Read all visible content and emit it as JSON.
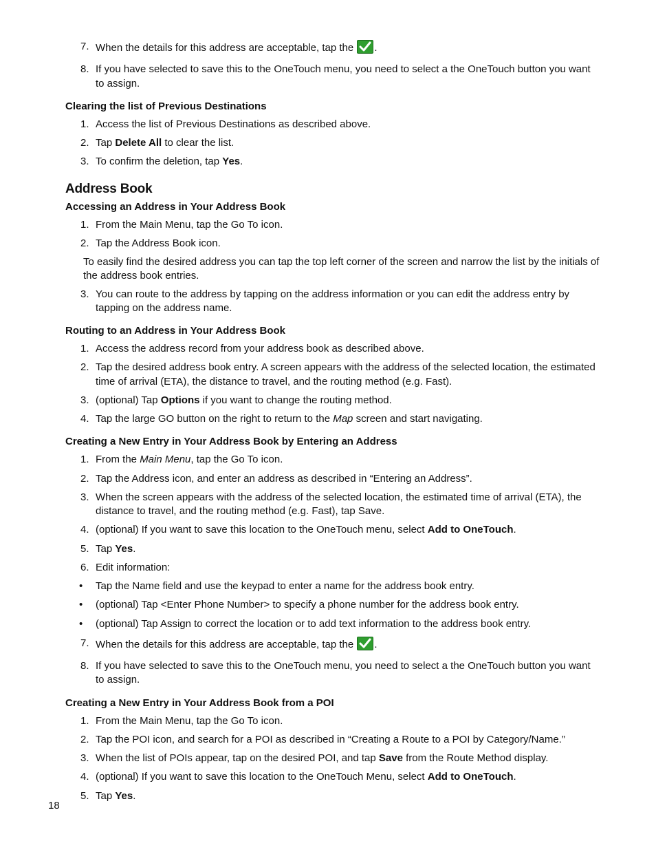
{
  "icons": {
    "check_name": "check-icon"
  },
  "top_list": {
    "i7": {
      "marker": "7.",
      "pre": "When the details for this address are acceptable, tap the ",
      "post": "."
    },
    "i8": {
      "marker": "8.",
      "text": "If you have selected to save this to the OneTouch menu, you need to select a the OneTouch button you want to assign."
    }
  },
  "clearing": {
    "heading": "Clearing the list of Previous Destinations",
    "i1": {
      "marker": "1.",
      "text": "Access the list of Previous Destinations as described above."
    },
    "i2": {
      "marker": "2.",
      "pre": "Tap ",
      "bold": "Delete All",
      "post": " to clear the list."
    },
    "i3": {
      "marker": "3.",
      "pre": "To confirm the deletion, tap ",
      "bold": "Yes",
      "post": "."
    }
  },
  "address_book_heading": "Address Book",
  "accessing": {
    "heading": "Accessing an Address in Your Address Book",
    "i1": {
      "marker": "1.",
      "text": "From the Main Menu, tap the Go To icon."
    },
    "i2": {
      "marker": "2.",
      "text": "Tap the Address Book icon."
    },
    "note": "To easily find the desired address you can tap the top left corner of the screen and narrow the list by the initials of the address book entries.",
    "i3": {
      "marker": "3.",
      "text": "You can route to the address by tapping on the address information or you can edit the address entry by tapping on the address name."
    }
  },
  "routing": {
    "heading": "Routing to an Address in Your Address Book",
    "i1": {
      "marker": "1.",
      "text": "Access the address record from your address book as described above."
    },
    "i2": {
      "marker": "2.",
      "text": "Tap the desired address book entry. A screen appears with the address of the selected location, the estimated time of arrival (ETA), the distance to travel, and the routing method (e.g. Fast)."
    },
    "i3": {
      "marker": "3.",
      "pre": "(optional) Tap ",
      "bold": "Options",
      "post": " if you want to change the routing method."
    },
    "i4": {
      "marker": "4.",
      "pre": "Tap the large GO button on the right to return to the ",
      "ital": "Map",
      "post": " screen and start navigating."
    }
  },
  "creating_addr": {
    "heading": "Creating a New Entry in Your Address Book by Entering an Address",
    "i1": {
      "marker": "1.",
      "pre": "From the ",
      "ital": "Main Menu",
      "post": ", tap the Go To icon."
    },
    "i2": {
      "marker": "2.",
      "text": "Tap the Address icon, and enter an address as described in “Entering an Address”."
    },
    "i3": {
      "marker": "3.",
      "text": "When the screen appears with the address of the selected location, the estimated time of arrival (ETA), the distance to travel, and the routing method (e.g. Fast), tap Save."
    },
    "i4": {
      "marker": "4.",
      "pre": "(optional) If you want to save this location to the OneTouch menu, select ",
      "bold": "Add to OneTouch",
      "post": "."
    },
    "i5": {
      "marker": "5.",
      "pre": "Tap ",
      "bold": "Yes",
      "post": "."
    },
    "i6": {
      "marker": "6.",
      "text": "Edit information:"
    },
    "b1": "Tap the Name field and use the keypad to enter a name for the address book entry.",
    "b2": "(optional) Tap <Enter Phone Number> to specify a phone number for the address book entry.",
    "b3": "(optional) Tap Assign to correct the location or to add text information to the address book entry.",
    "i7": {
      "marker": "7.",
      "pre": "When the details for this address are acceptable, tap the ",
      "post": "."
    },
    "i8": {
      "marker": "8.",
      "text": "If you have selected to save this to the OneTouch menu, you need to select a the OneTouch button you want to assign."
    }
  },
  "creating_poi": {
    "heading": "Creating a New Entry in Your Address Book from a POI",
    "i1": {
      "marker": "1.",
      "text": "From the Main Menu, tap the Go To icon."
    },
    "i2": {
      "marker": "2.",
      "text": "Tap the POI icon, and search for a POI as described in “Creating a Route to a POI by Category/Name.”"
    },
    "i3": {
      "marker": "3.",
      "pre": "When the list of POIs appear, tap on the desired POI, and tap ",
      "bold": "Save",
      "post": " from the Route Method display."
    },
    "i4": {
      "marker": "4.",
      "pre": "(optional) If you want to save this location to the OneTouch Menu, select ",
      "bold": "Add to OneTouch",
      "post": "."
    },
    "i5": {
      "marker": "5.",
      "pre": "Tap ",
      "bold": "Yes",
      "post": "."
    }
  },
  "page_number": "18"
}
